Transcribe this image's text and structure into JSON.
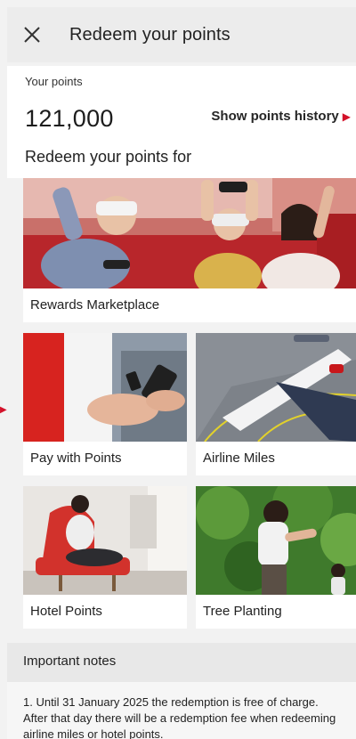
{
  "header": {
    "title": "Redeem your points",
    "close_icon": "close-icon"
  },
  "points": {
    "label": "Your points",
    "value": "121,000",
    "history_link": "Show points history",
    "history_icon": "chevron-right-icon"
  },
  "redeem": {
    "section_title": "Redeem your points for",
    "options": [
      {
        "label": "Rewards Marketplace"
      },
      {
        "label": "Pay with Points"
      },
      {
        "label": "Airline Miles"
      },
      {
        "label": "Hotel Points"
      },
      {
        "label": "Tree Planting"
      }
    ]
  },
  "notes": {
    "title": "Important notes",
    "text": "1. Until 31 January 2025 the redemption is free of charge. After that day there will be a redemption fee when redeeming airline miles or hotel points."
  },
  "colors": {
    "accent": "#d3122a",
    "background": "#f2f2f2",
    "card": "#ffffff"
  }
}
